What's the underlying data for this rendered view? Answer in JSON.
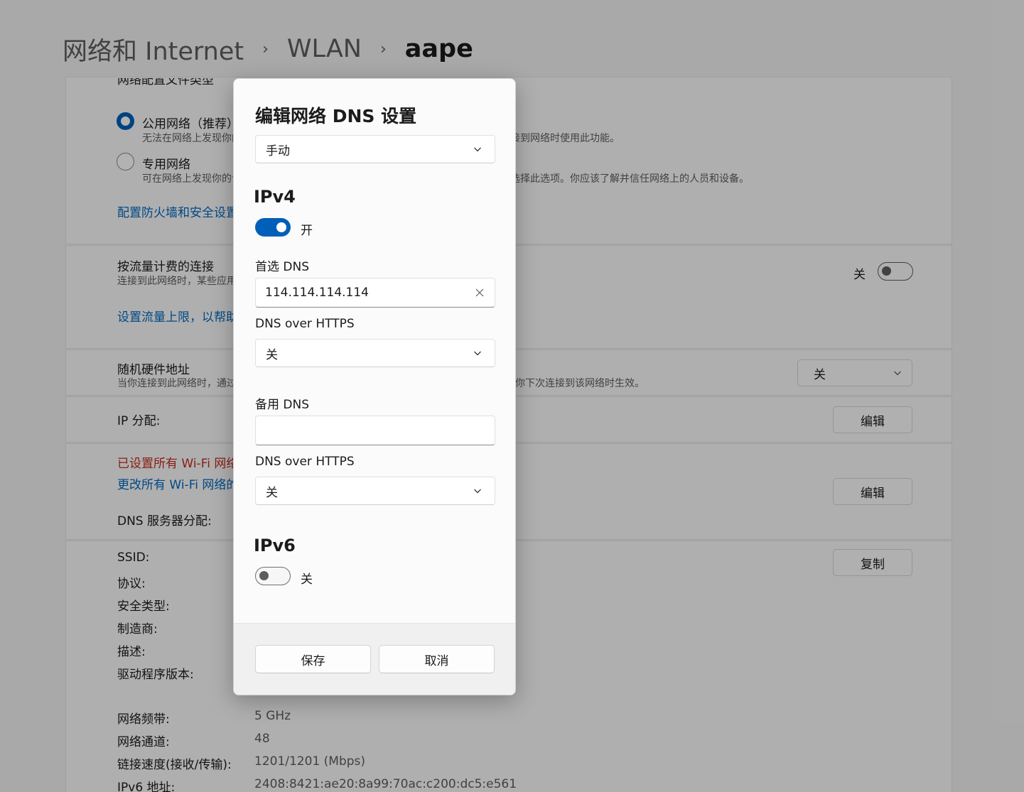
{
  "breadcrumb": {
    "root": "网络和 Internet",
    "mid": "WLAN",
    "current": "aape"
  },
  "background": {
    "profile_header": "网络配置文件类型",
    "public_label": "公用网络（推荐）",
    "public_desc": "无法在网络上发现你的设备。在大多数情况下，例如在家里、工作单位或公共场所连接到网络时使用此功能。",
    "private_label": "专用网络",
    "private_desc": "可在网络上发现你的设备。如果需要文件共享或使用通过此网络进行通信的应用，请选择此选项。你应该了解并信任网络上的人员和设备。",
    "firewall_link": "配置防火墙和安全设置",
    "metered_title": "按流量计费的连接",
    "metered_desc": "连接到此网络时，某些应用可能会以不同的方式工作以减少数据使用量",
    "metered_state": "关",
    "data_limit_link": "设置流量上限，以帮助控制此网络上的数据使用量",
    "random_mac_title": "随机硬件地址",
    "random_mac_desc": "当你连接到此网络时，通过使用随机硬件地址，使他人更难跟踪你的设备位置。此设置将在你下次连接到该网络时生效。",
    "random_mac_value": "关",
    "ip_assign_label": "IP 分配:",
    "edit_label": "编辑",
    "wifi_warning": "已设置所有 Wi-Fi 网络的 DNS",
    "wifi_change_link": "更改所有 Wi-Fi 网络的 DNS",
    "dns_assign_label": "DNS 服务器分配:",
    "copy_label": "复制",
    "props": [
      {
        "label": "SSID:",
        "value": ""
      },
      {
        "label": "协议:",
        "value": ""
      },
      {
        "label": "安全类型:",
        "value": ""
      },
      {
        "label": "制造商:",
        "value": ""
      },
      {
        "label": "描述:",
        "value": ""
      },
      {
        "label": "驱动程序版本:",
        "value": ""
      }
    ],
    "props2": [
      {
        "label": "网络频带:",
        "value": "5 GHz"
      },
      {
        "label": "网络通道:",
        "value": "48"
      },
      {
        "label": "链接速度(接收/传输):",
        "value": "1201/1201 (Mbps)"
      },
      {
        "label": "IPv6 地址:",
        "value": "2408:8421:ae20:8a99:70ac:c200:dc5:e561"
      }
    ]
  },
  "dialog": {
    "title": "编辑网络 DNS 设置",
    "mode": "手动",
    "ipv4": {
      "header": "IPv4",
      "state": "开",
      "preferred_label": "首选 DNS",
      "preferred_value": "114.114.114.114",
      "doh_label": "DNS over HTTPS",
      "doh_value": "关",
      "alternate_label": "备用 DNS",
      "alternate_value": "",
      "doh2_label": "DNS over HTTPS",
      "doh2_value": "关"
    },
    "ipv6": {
      "header": "IPv6",
      "state": "关"
    },
    "save": "保存",
    "cancel": "取消"
  },
  "colors": {
    "accent": "#005fb8",
    "link": "#0067c0",
    "warning": "#c42b1c"
  }
}
